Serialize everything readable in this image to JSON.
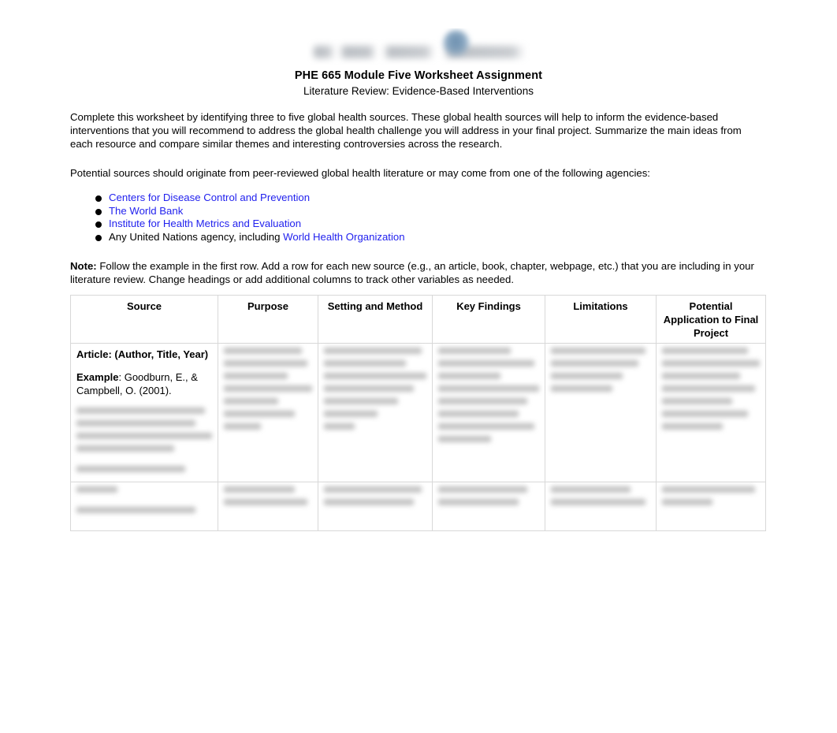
{
  "header": {
    "logo_alt": "university-logo",
    "title": "PHE 665 Module Five Worksheet Assignment",
    "subtitle": "Literature Review: Evidence-Based Interventions"
  },
  "body": {
    "intro_paragraph": "Complete this worksheet by identifying three to five global health sources. These global health sources will help to inform the evidence-based interventions that you will recommend to address the global health challenge you will address in your final project. Summarize the main ideas from each resource and compare similar themes and interesting controversies across the research.",
    "sources_paragraph": "Potential sources should originate from peer-reviewed global health literature or may come from one of the following agencies:",
    "note_label": "Note:",
    "note_text": " Follow the example in the first row. Add a row for each new source (e.g., an article, book, chapter, webpage, etc.) that you are including in your literature review. Change headings or add additional columns to track other variables as needed."
  },
  "agency_bullets": [
    {
      "text": "Centers for Disease Control and Prevention",
      "is_link": true
    },
    {
      "text": "The World Bank",
      "is_link": true
    },
    {
      "text": "Institute for Health Metrics and Evaluation",
      "is_link": true
    },
    {
      "prefix": "Any United Nations agency, including ",
      "link_text": "World Health Organization",
      "is_link": false
    }
  ],
  "table": {
    "headers": [
      "Source",
      "Purpose",
      "Setting and Method",
      "Key Findings",
      "Limitations",
      "Potential Application to Final Project"
    ],
    "rows": [
      {
        "source_heading": "Article: (Author, Title, Year)",
        "source_example_label": "Example",
        "source_example_text": ": Goodburn, E., & Campbell, O. (2001).",
        "source_redacted": true,
        "purpose": "",
        "setting_and_method": "",
        "key_findings": "",
        "limitations": "",
        "potential_application": ""
      },
      {
        "source_heading": "",
        "source_example_label": "",
        "source_example_text": "",
        "purpose": "",
        "setting_and_method": "",
        "key_findings": "",
        "limitations": "",
        "potential_application": ""
      }
    ]
  },
  "colors": {
    "link": "#2222ee",
    "text": "#000000",
    "border": "#d8d8d8",
    "page_background": "#ffffff"
  }
}
